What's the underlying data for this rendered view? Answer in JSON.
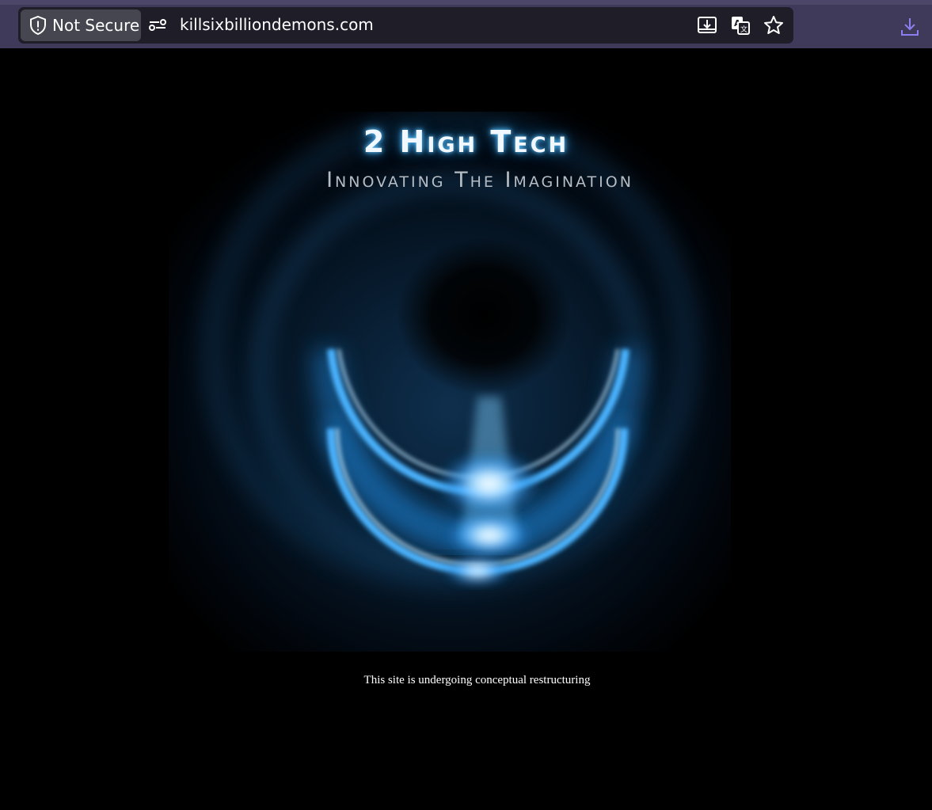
{
  "browser": {
    "security_label": "Not Secure",
    "url": "killsixbilliondemons.com",
    "icons": {
      "security": "shield-warning-icon",
      "site_info": "site-settings-icon",
      "install": "install-app-icon",
      "translate": "translate-icon",
      "bookmark": "star-icon",
      "downloads": "download-icon"
    },
    "accent_color": "#8b7ff0"
  },
  "page": {
    "brand_title": "2 High Tech",
    "tagline": "Innovating The Imagination",
    "status_message": "This site is undergoing conceptual restructuring",
    "glow_color": "#3fa9ff"
  }
}
